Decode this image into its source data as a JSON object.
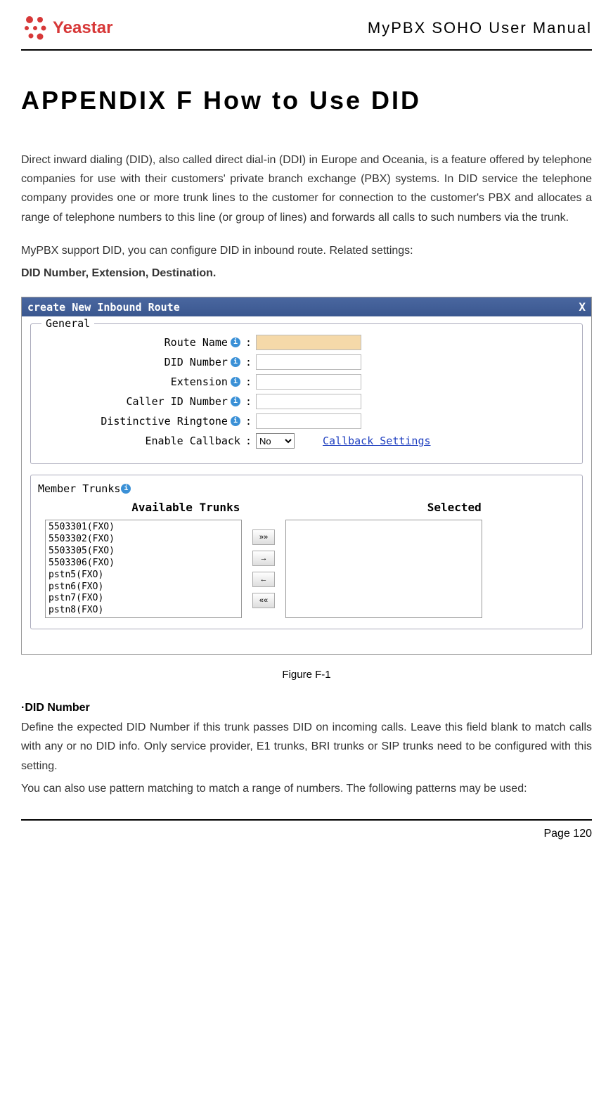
{
  "header": {
    "logo_text": "Yeastar",
    "manual_title": "MyPBX SOHO User Manual"
  },
  "content": {
    "title": "APPENDIX F How to Use DID",
    "intro_para": "Direct inward dialing (DID), also called direct dial-in (DDI) in Europe and Oceania, is a feature offered by telephone companies for use with their customers' private branch exchange (PBX) systems. In DID service the telephone company provides one or more trunk lines to the customer for connection to the customer's PBX and allocates a range of telephone numbers to this line (or group of lines) and forwards all calls to such numbers via the trunk.",
    "support_para": "MyPBX support DID, you can configure DID in inbound route. Related settings:",
    "support_bold": "DID Number, Extension, Destination."
  },
  "figure": {
    "titlebar": "create New Inbound Route",
    "close": "X",
    "general": {
      "legend": "General",
      "route_name_label": "Route Name",
      "did_number_label": "DID Number",
      "extension_label": "Extension",
      "caller_id_label": "Caller ID Number",
      "ringtone_label": "Distinctive Ringtone",
      "callback_label": "Enable Callback",
      "callback_value": "No",
      "callback_link": "Callback Settings"
    },
    "trunks": {
      "member_label": "Member Trunks",
      "available_header": "Available Trunks",
      "selected_header": "Selected",
      "available": [
        "5503301(FXO)",
        "5503302(FXO)",
        "5503305(FXO)",
        "5503306(FXO)",
        "pstn5(FXO)",
        "pstn6(FXO)",
        "pstn7(FXO)",
        "pstn8(FXO)"
      ],
      "btn_add_all": "»»",
      "btn_add": "→",
      "btn_remove": "←",
      "btn_remove_all": "««"
    },
    "caption": "Figure F-1"
  },
  "section": {
    "heading": "·DID Number",
    "para1": "Define the expected DID Number if this trunk passes DID on incoming calls. Leave this field blank to match calls with any or no DID info. Only service provider, E1 trunks, BRI trunks or SIP trunks need to be configured with this setting.",
    "para2": "You can also use pattern matching to match a range of numbers. The following patterns may be used:"
  },
  "footer": {
    "page": "Page 120"
  }
}
